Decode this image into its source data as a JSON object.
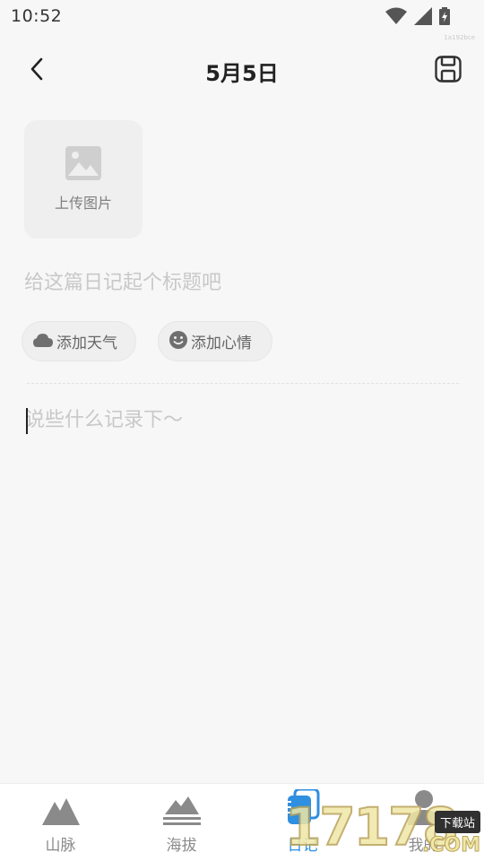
{
  "status_bar": {
    "time": "10:52",
    "build_tag": "1a192bce",
    "icons": [
      "wifi-icon",
      "cell-signal-icon",
      "battery-charging-icon"
    ]
  },
  "header": {
    "title": "5月5日",
    "back_icon": "chevron-left-icon",
    "save_icon": "save-icon"
  },
  "upload": {
    "label": "上传图片",
    "icon": "image-icon"
  },
  "title_input": {
    "value": "",
    "placeholder": "给这篇日记起个标题吧"
  },
  "chips": {
    "weather": {
      "label": "添加天气",
      "icon": "cloud-icon"
    },
    "mood": {
      "label": "添加心情",
      "icon": "smiley-icon"
    }
  },
  "content_input": {
    "value": "",
    "placeholder": "说些什么记录下～"
  },
  "tabbar": {
    "tabs": [
      {
        "label": "山脉",
        "icon": "mountain-icon",
        "active": false
      },
      {
        "label": "海拔",
        "icon": "altitude-icon",
        "active": false
      },
      {
        "label": "日记",
        "icon": "diary-icon",
        "active": true
      },
      {
        "label": "我的",
        "icon": "user-icon",
        "active": false
      }
    ]
  },
  "watermark": {
    "digits": "17178",
    "site": "下载站",
    "com": ".COM"
  },
  "colors": {
    "background": "#f7f7f7",
    "accent": "#2f8fe0",
    "placeholder": "#c8c8c8",
    "chip_bg": "#efefef"
  }
}
